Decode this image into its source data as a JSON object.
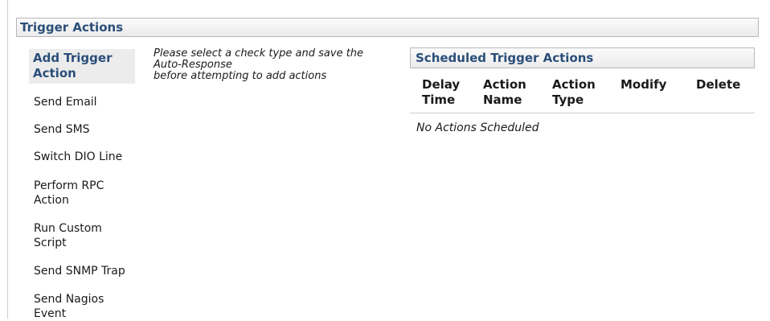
{
  "section": {
    "title": "Trigger Actions"
  },
  "add_menu": {
    "header": "Add Trigger Action",
    "items": [
      {
        "label": "Send Email"
      },
      {
        "label": "Send SMS"
      },
      {
        "label": "Switch DIO Line"
      },
      {
        "label": "Perform RPC Action"
      },
      {
        "label": "Run Custom Script"
      },
      {
        "label": "Send SNMP Trap"
      },
      {
        "label": "Send Nagios Event"
      }
    ]
  },
  "message": {
    "line1": "Please select a check type and save the",
    "line2": "Auto-Response",
    "line3": "before attempting to add actions"
  },
  "scheduled": {
    "title": "Scheduled Trigger Actions",
    "columns": [
      {
        "label": "Delay Time"
      },
      {
        "label": "Action Name"
      },
      {
        "label": "Action Type"
      },
      {
        "label": "Modify"
      },
      {
        "label": "Delete"
      }
    ],
    "empty_text": "No Actions Scheduled"
  },
  "colors": {
    "header_text": "#2b4f7a",
    "header_bg": "#ebebeb",
    "border": "#b8b8b8"
  }
}
